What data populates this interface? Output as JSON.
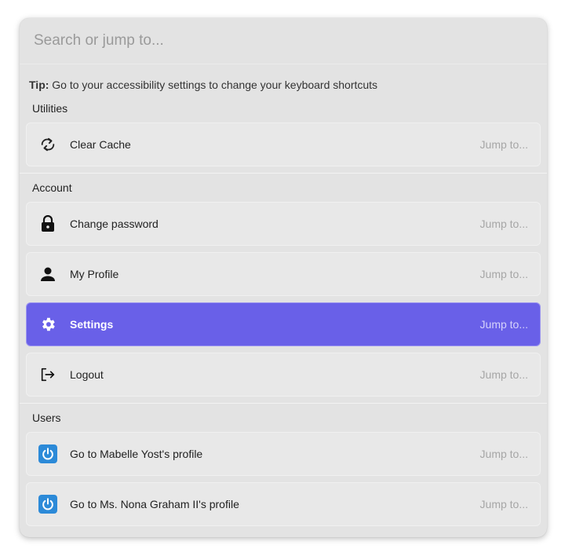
{
  "search": {
    "placeholder": "Search or jump to..."
  },
  "tip": {
    "label": "Tip:",
    "text": " Go to your accessibility settings to change your keyboard shortcuts"
  },
  "sections": {
    "utilities": {
      "title": "Utilities",
      "items": [
        {
          "label": "Clear Cache",
          "icon": "refresh-icon",
          "hint": "Jump to..."
        }
      ]
    },
    "account": {
      "title": "Account",
      "items": [
        {
          "label": "Change password",
          "icon": "lock-icon",
          "hint": "Jump to..."
        },
        {
          "label": "My Profile",
          "icon": "person-icon",
          "hint": "Jump to..."
        },
        {
          "label": "Settings",
          "icon": "gear-icon",
          "hint": "Jump to...",
          "active": true
        },
        {
          "label": "Logout",
          "icon": "logout-icon",
          "hint": "Jump to..."
        }
      ]
    },
    "users": {
      "title": "Users",
      "items": [
        {
          "label": "Go to Mabelle Yost's profile",
          "icon": "power-icon",
          "hint": "Jump to..."
        },
        {
          "label": "Go to Ms. Nona Graham II's profile",
          "icon": "power-icon",
          "hint": "Jump to..."
        }
      ]
    }
  },
  "colors": {
    "accent": "#6960e8",
    "panel": "#e3e3e3",
    "item": "#e8e8e8",
    "app_icon": "#2c8ad8"
  }
}
